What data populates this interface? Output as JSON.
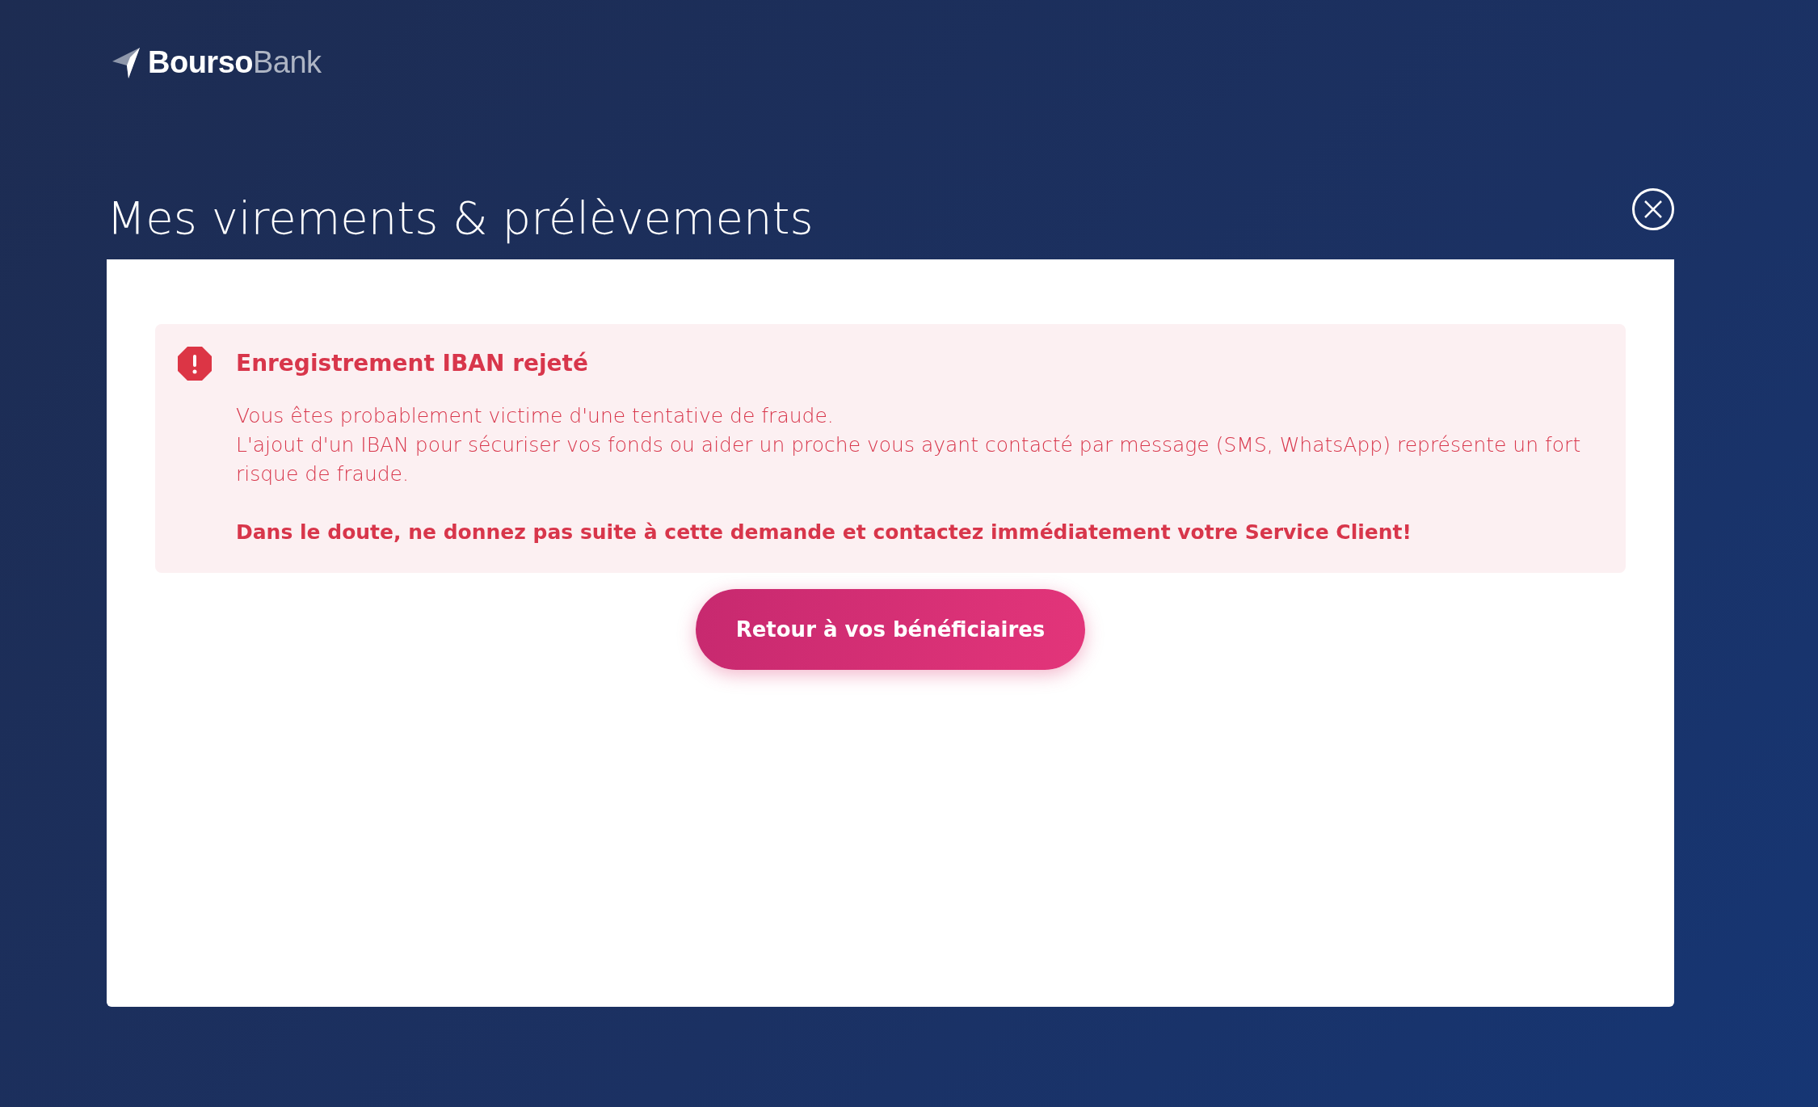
{
  "logo": {
    "primary": "Bourso",
    "secondary": "Bank"
  },
  "page_title": "Mes virements & prélèvements",
  "alert": {
    "title": "Enregistrement IBAN rejeté",
    "paragraphs": [
      "Vous êtes probablement victime d'une tentative de fraude.",
      "L'ajout d'un IBAN pour sécuriser vos fonds ou aider un proche vous ayant contacté par message (SMS, WhatsApp) représente un fort risque de fraude."
    ],
    "warning": "Dans le doute, ne donnez pas suite à cette demande et contactez immédiatement votre Service Client!"
  },
  "button": "Retour à vos bénéficiaires"
}
